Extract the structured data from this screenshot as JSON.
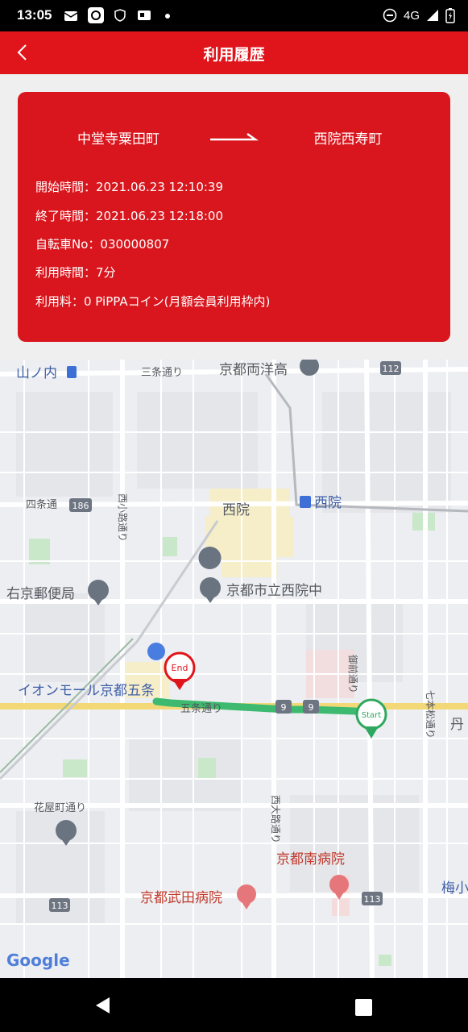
{
  "status_bar": {
    "time": "13:05",
    "network": "4G"
  },
  "app_bar": {
    "title": "利用履歴"
  },
  "trip": {
    "from": "中堂寺粟田町",
    "to": "西院西寿町",
    "start_time": "開始時間：2021.06.23  12:10:39",
    "end_time": "終了時間：2021.06.23  12:18:00",
    "bike_no": "自転車No：030000807",
    "duration": "利用時間：7分",
    "fee": "利用料：0 PiPPAコイン(月額会員利用枠内)"
  },
  "map": {
    "labels": {
      "yamanouchi": "山ノ内",
      "sanjo_dori": "三条通り",
      "kyoto_ryoyo": "京都両洋高",
      "route112": "112",
      "shijo_dori": "四条通",
      "route186": "186",
      "nishikoji": "西小路通り",
      "saiin": "西院",
      "saiin_station": "西院",
      "ukyo_post": "右京郵便局",
      "saiin_jhs": "京都市立西院中",
      "aeon": "イオンモール京都五条",
      "gojo_dori": "五条通り",
      "route9a": "9",
      "route9b": "9",
      "onmae": "御前通り",
      "shichihon": "七本松通り",
      "tan": "丹",
      "hanayamachi": "花屋町通り",
      "nishioji": "西大路通り",
      "minami_hosp": "京都南病院",
      "takeda_hosp": "京都武田病院",
      "route113a": "113",
      "route113b": "113",
      "ume": "梅小",
      "end_pin": "End",
      "start_pin": "Start",
      "google": "Google"
    }
  },
  "colors": {
    "accent": "#e0151b",
    "card": "#d9161d",
    "route": "#3dba6f"
  }
}
